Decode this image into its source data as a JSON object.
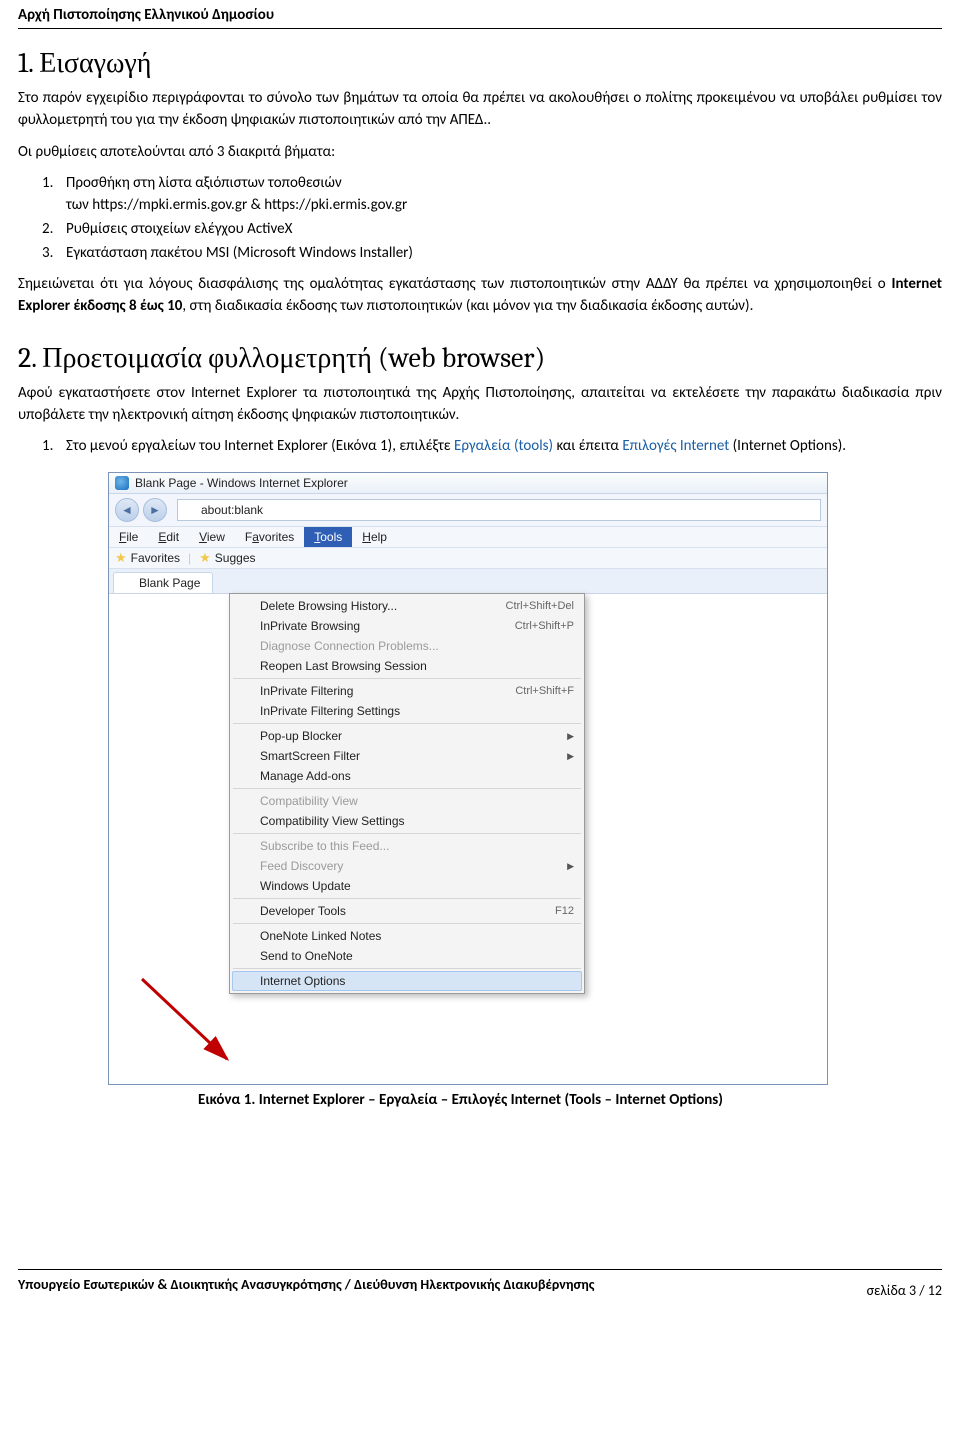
{
  "doc_header": "Αρχή Πιστοποίησης Ελληνικού Δημοσίου",
  "section1": {
    "title": "1. Εισαγωγή",
    "para1": "Στο παρόν εγχειρίδιο περιγράφονται το σύνολο των βημάτων τα οποία θα πρέπει να ακολουθήσει ο πολίτης προκειμένου να υποβάλει ρυθμίσει τον φυλλομετρητή του για την έκδοση ψηφιακών πιστοποιητικών από την ΑΠΕΔ..",
    "para2": "Οι ρυθμίσεις αποτελούνται από 3 διακριτά βήματα:",
    "items": [
      {
        "n": "1.",
        "txt": "Προσθήκη στη λίστα αξιόπιστων τοποθεσιών",
        "txt2": "των https://mpki.ermis.gov.gr & https://pki.ermis.gov.gr"
      },
      {
        "n": "2.",
        "txt": "Ρυθμίσεις στοιχείων ελέγχου ActiveX"
      },
      {
        "n": "3.",
        "txt": "Εγκατάσταση πακέτου MSI (Microsoft Windows Installer)"
      }
    ],
    "note_pre": "Σημειώνεται ότι για λόγους διασφάλισης της ομαλότητας εγκατάστασης των πιστοποιητικών στην ΑΔΔΥ θα πρέπει να χρησιμοποιηθεί ο ",
    "note_bold1": "Internet Explorer έκδοσης 8 έως 10",
    "note_post": ", στη διαδικασία έκδοσης των πιστοποιητικών (και μόνον για την διαδικασία έκδοσης αυτών)."
  },
  "section2": {
    "title": "2. Προετοιμασία φυλλομετρητή (web browser)",
    "para1": "Αφού εγκαταστήσετε στον Internet Explorer τα πιστοποιητικά της Αρχής Πιστοποίησης, απαιτείται να εκτελέσετε την παρακάτω διαδικασία πριν υποβάλετε την ηλεκτρονική αίτηση έκδοσης ψηφιακών πιστοποιητικών.",
    "step1_pre": "Στο μενού εργαλείων του Internet Explorer (Εικόνα 1), επιλέξτε ",
    "step1_link1": "Εργαλεία (tools)",
    "step1_mid": " και έπειτα ",
    "step1_link2": "Επιλογές Internet",
    "step1_post": " (Internet Options)."
  },
  "ie": {
    "title": "Blank Page - Windows Internet Explorer",
    "url": "about:blank",
    "menus": [
      "File",
      "Edit",
      "View",
      "Favorites",
      "Tools",
      "Help"
    ],
    "fav_label": "Favorites",
    "sugges": "Sugges",
    "tab": "Blank Page",
    "dropdown": [
      {
        "label": "Delete Browsing History...",
        "shortcut": "Ctrl+Shift+Del"
      },
      {
        "label": "InPrivate Browsing",
        "shortcut": "Ctrl+Shift+P"
      },
      {
        "label": "Diagnose Connection Problems...",
        "disabled": true
      },
      {
        "label": "Reopen Last Browsing Session"
      },
      {
        "sep": true
      },
      {
        "label": "InPrivate Filtering",
        "shortcut": "Ctrl+Shift+F"
      },
      {
        "label": "InPrivate Filtering Settings"
      },
      {
        "sep": true
      },
      {
        "label": "Pop-up Blocker",
        "sub": true
      },
      {
        "label": "SmartScreen Filter",
        "sub": true
      },
      {
        "label": "Manage Add-ons"
      },
      {
        "sep": true
      },
      {
        "label": "Compatibility View",
        "disabled": true
      },
      {
        "label": "Compatibility View Settings"
      },
      {
        "sep": true
      },
      {
        "label": "Subscribe to this Feed...",
        "disabled": true
      },
      {
        "label": "Feed Discovery",
        "sub": true,
        "disabled": true
      },
      {
        "label": "Windows Update"
      },
      {
        "sep": true
      },
      {
        "label": "Developer Tools",
        "shortcut": "F12"
      },
      {
        "sep": true
      },
      {
        "label": "OneNote Linked Notes"
      },
      {
        "label": "Send to OneNote"
      },
      {
        "sep": true
      },
      {
        "label": "Internet Options",
        "hover": true
      }
    ]
  },
  "caption": "Εικόνα 1. Internet Explorer – Εργαλεία – Επιλογές Internet (Tools – Internet Options)",
  "footer": {
    "left": "Υπουργείο Εσωτερικών & Διοικητικής Ανασυγκρότησης / Διεύθυνση Ηλεκτρονικής Διακυβέρνησης",
    "page": "σελίδα 3 / 12"
  }
}
